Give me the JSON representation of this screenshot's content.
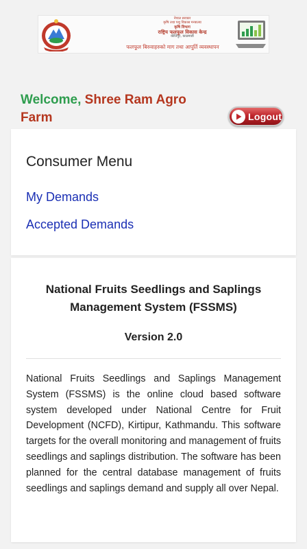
{
  "banner": {
    "line1": "नेपाल सरकार",
    "line2": "कृषि तथा पशु विकास मन्त्रालय",
    "line3": "कृषि विभाग",
    "line4": "राष्ट्रिय फलफूल विकास केन्द्र",
    "line5": "कीर्तिपुर, काठमाडौं",
    "slogan": "फलफूल बिरुवाहरुको माग तथा आपूर्ति व्यवस्थापन"
  },
  "welcome": {
    "prefix": "Welcome,",
    "name": "Shree Ram Agro Farm"
  },
  "logout": {
    "label": "Logout"
  },
  "menu": {
    "title": "Consumer Menu",
    "items": [
      {
        "label": "My Demands"
      },
      {
        "label": "Accepted Demands"
      }
    ]
  },
  "info": {
    "title": "National Fruits Seedlings and Saplings Management System (FSSMS)",
    "version": "Version 2.0",
    "description": "National Fruits Seedlings and Saplings Management System (FSSMS) is the online cloud based software system developed under National Centre for Fruit Development (NCFD), Kirtipur, Kathmandu. This software targets for the overall monitoring and management of fruits seedlings and saplings distribution. The software has been planned for the central database management of fruits seedlings and saplings demand and supply all over Nepal."
  },
  "colors": {
    "welcome": "#2e9d4e",
    "name": "#b5371f",
    "link": "#1a2fb4",
    "logout": "#c0272d"
  }
}
